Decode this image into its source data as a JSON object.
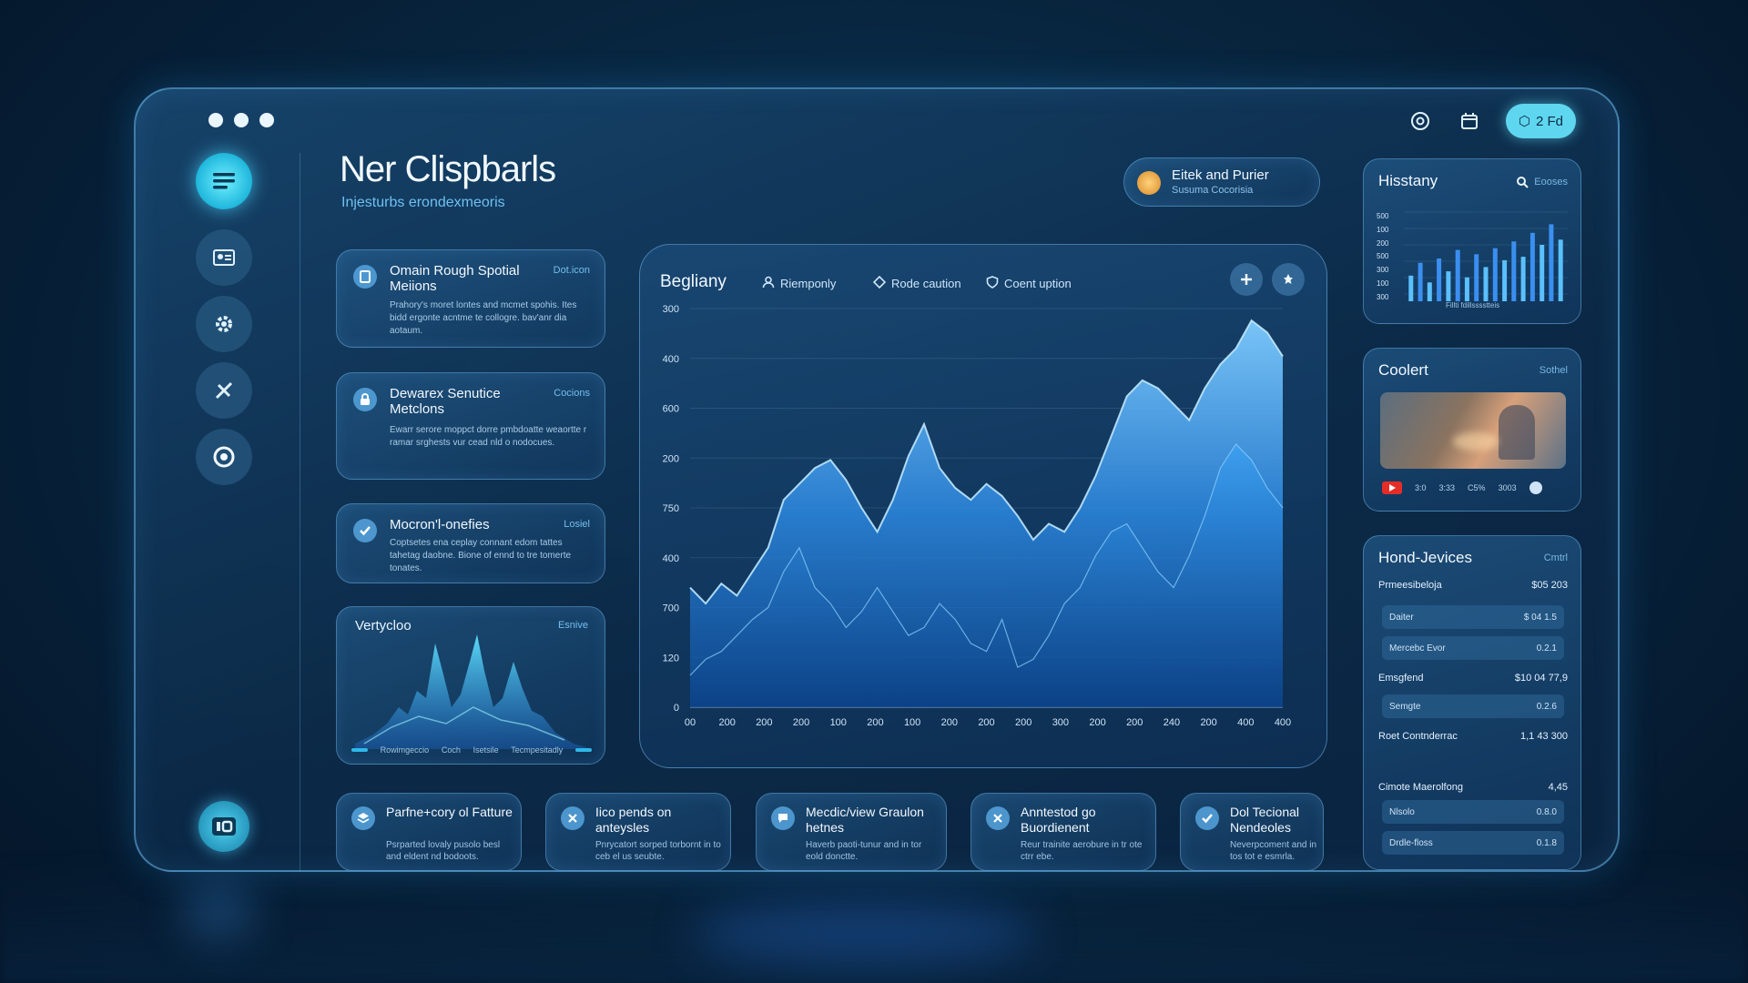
{
  "window": {
    "status_button": "2 Fd"
  },
  "header": {
    "title": "Ner Clispbarls",
    "subtitle": "Injesturbs erondexmeoris"
  },
  "promo_pill": {
    "title": "Eitek and Purier",
    "subtitle": "Susuma Cocorisia"
  },
  "feature_cards": [
    {
      "title": "Omain Rough Spotial Meiions",
      "tag": "Dot.icon",
      "desc": "Prahory's moret lontes and mcmet spohis. Ites bidd ergonte acntme te collogre. bav'anr dia aotaum."
    },
    {
      "title": "Dewarex Senutice Metclons",
      "tag": "Cocions",
      "desc": "Ewarr serore moppct dorre pmbdoatte weaortte r ramar srghests vur cead nld o nodocues."
    },
    {
      "title": "Mocron'l-onefies",
      "tag": "Losiel",
      "desc": "Coptsetes ena ceplay connant edom tattes tahetag daobne. Bione of ennd to tre tomerte tonates."
    }
  ],
  "mini_chart": {
    "title": "Vertycloo",
    "tag": "Esnive",
    "labels": [
      "Rowimgeccio",
      "Coch",
      "Isetsile",
      "Tecmpesitadly"
    ]
  },
  "main_chart": {
    "title": "Begliany",
    "tabs": [
      "Riemponly",
      "Rode caution",
      "Coent uption"
    ]
  },
  "chart_data": {
    "type": "area",
    "title": "Begliany",
    "y_tick_labels": [
      "0",
      "120",
      "700",
      "400",
      "750",
      "200",
      "600",
      "400",
      "300"
    ],
    "x_tick_labels": [
      "00",
      "200",
      "200",
      "200",
      "100",
      "200",
      "100",
      "200",
      "200",
      "200",
      "300",
      "200",
      "200",
      "240",
      "200",
      "400",
      "400"
    ],
    "series": [
      {
        "values": [
          0.3,
          0.26,
          0.31,
          0.28,
          0.34,
          0.4,
          0.52,
          0.56,
          0.6,
          0.62,
          0.57,
          0.5,
          0.44,
          0.52,
          0.63,
          0.71,
          0.6,
          0.55,
          0.52,
          0.56,
          0.53,
          0.48,
          0.42,
          0.46,
          0.44,
          0.5,
          0.58,
          0.68,
          0.78,
          0.82,
          0.8,
          0.76,
          0.72,
          0.8,
          0.86,
          0.9,
          0.97,
          0.94,
          0.88
        ]
      },
      {
        "values": [
          0.08,
          0.12,
          0.14,
          0.18,
          0.22,
          0.25,
          0.34,
          0.4,
          0.3,
          0.26,
          0.2,
          0.24,
          0.3,
          0.24,
          0.18,
          0.2,
          0.26,
          0.22,
          0.16,
          0.14,
          0.22,
          0.1,
          0.12,
          0.18,
          0.26,
          0.3,
          0.38,
          0.44,
          0.46,
          0.4,
          0.34,
          0.3,
          0.38,
          0.48,
          0.6,
          0.66,
          0.62,
          0.55,
          0.5
        ]
      }
    ]
  },
  "bottom_cards": [
    {
      "title": "Parfne+cory ol Fatture",
      "desc": "Psrparted lovaly pusolo besl and eldent nd bodoots."
    },
    {
      "title": "Iico pends on anteysles",
      "desc": "Pnrycatort sorped torbornt in to ceb el us seubte."
    },
    {
      "title": "Mecdic/view Graulon hetnes",
      "desc": "Haverb paoti-tunur and in tor eold donctte."
    },
    {
      "title": "Anntestod go Buordienent",
      "desc": "Reur trainite aerobure in tr ote ctrr ebe."
    },
    {
      "title": "Dol Tecional Nendeoles",
      "desc": "Neverpcoment and in tos tot e esmrla."
    }
  ],
  "history": {
    "title": "Hisstany",
    "search": "Eooses",
    "y_labels": [
      "500",
      "100",
      "200",
      "500",
      "300",
      "100",
      "300"
    ],
    "x_caption": "Fillti fdillsssstteis",
    "bars": [
      0.3,
      0.45,
      0.22,
      0.5,
      0.35,
      0.6,
      0.28,
      0.55,
      0.4,
      0.62,
      0.48,
      0.7,
      0.52,
      0.8,
      0.66,
      0.9,
      0.72
    ]
  },
  "video_card": {
    "title": "Coolert",
    "tag": "Sothel",
    "controls": [
      "3:0",
      "3:33",
      "C5%",
      "3003"
    ]
  },
  "services": {
    "title": "Hond-Jevices",
    "tag": "Cmtrl",
    "rows": [
      {
        "label": "Prmeesibeloja",
        "value": "$05 203"
      },
      {
        "label": "Emsgfend",
        "value": "$10 04 77,9"
      },
      {
        "label": "Roet Contnderrac",
        "value": "1,1 43 300"
      },
      {
        "label": "Cimote Maerolfong",
        "value": "4,45"
      }
    ],
    "subs": [
      {
        "label": "Daiter",
        "value": "$ 04 1.5"
      },
      {
        "label": "Mercebc Evor",
        "value": "0.2.1"
      },
      {
        "label": "Semgte",
        "value": "0.2.6"
      },
      {
        "label": "Nlsolo",
        "value": "0.8.0"
      },
      {
        "label": "Drdle-floss",
        "value": "0.1.8"
      }
    ]
  }
}
